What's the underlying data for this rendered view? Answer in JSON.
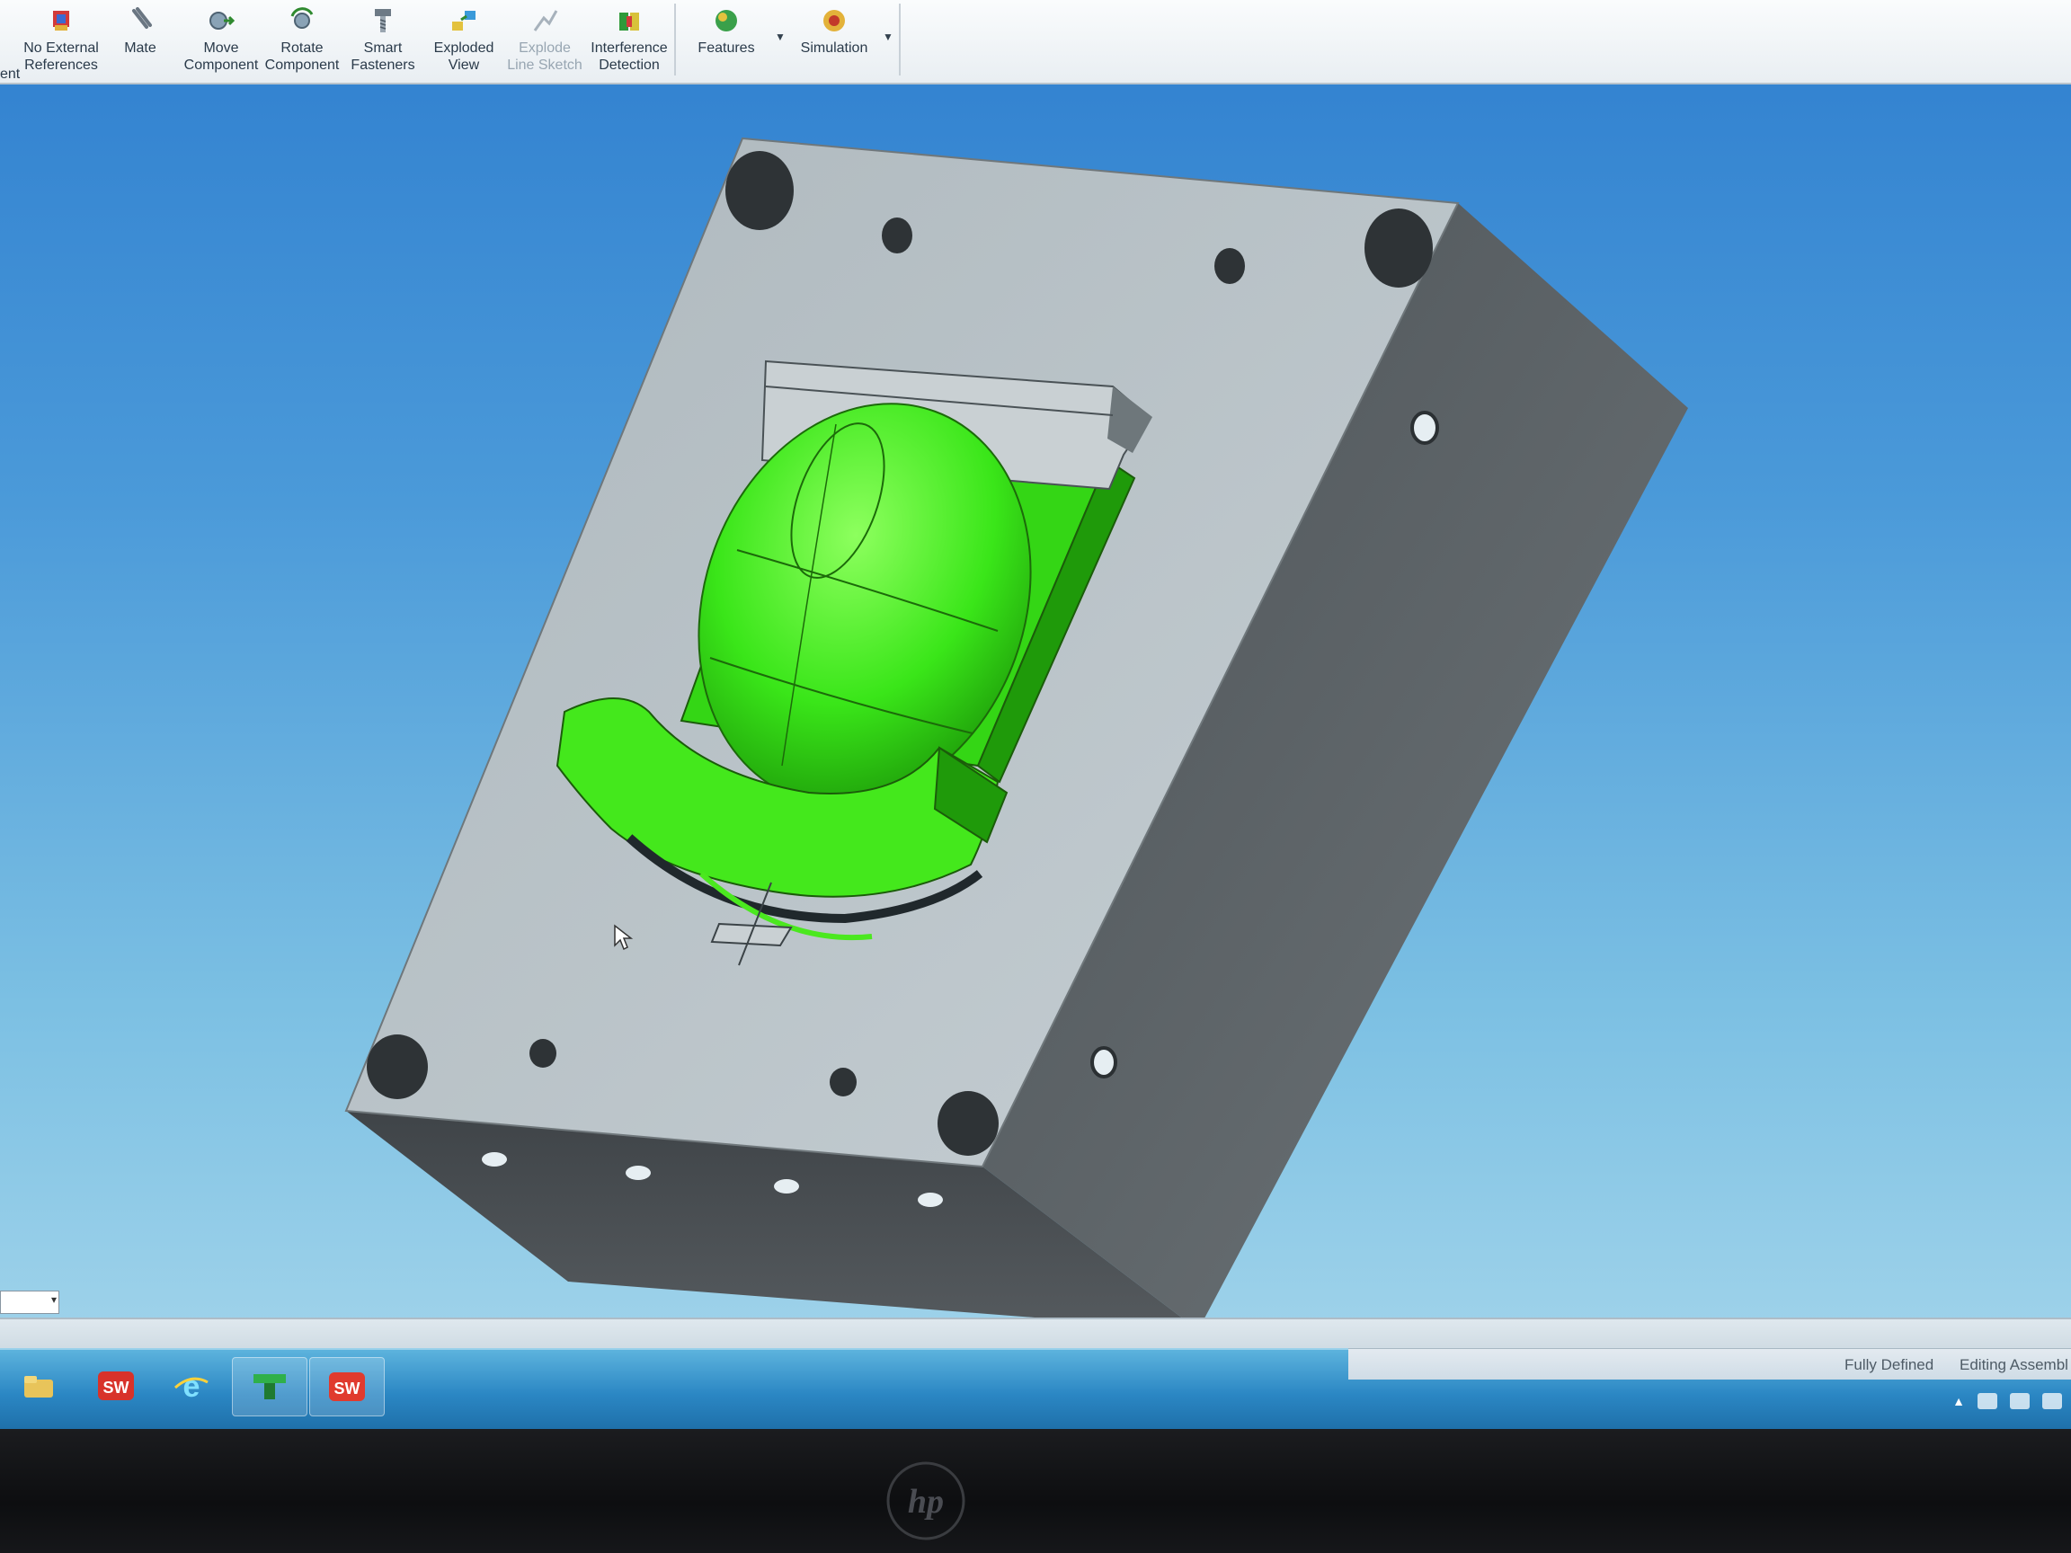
{
  "toolbar": {
    "cut_label": "ent",
    "buttons": [
      {
        "id": "no-external-references",
        "line1": "No External",
        "line2": "References",
        "icon": "no-external-references-icon"
      },
      {
        "id": "mate",
        "line1": "Mate",
        "line2": "",
        "icon": "mate-paperclip-icon"
      },
      {
        "id": "move-component",
        "line1": "Move",
        "line2": "Component",
        "icon": "move-component-icon"
      },
      {
        "id": "rotate-component",
        "line1": "Rotate",
        "line2": "Component",
        "icon": "rotate-component-icon"
      },
      {
        "id": "smart-fasteners",
        "line1": "Smart",
        "line2": "Fasteners",
        "icon": "smart-fasteners-icon"
      },
      {
        "id": "exploded-view",
        "line1": "Exploded",
        "line2": "View",
        "icon": "exploded-view-icon"
      },
      {
        "id": "explode-line-sketch",
        "line1": "Explode",
        "line2": "Line Sketch",
        "icon": "explode-line-sketch-icon",
        "disabled": true
      },
      {
        "id": "interference-detection",
        "line1": "Interference",
        "line2": "Detection",
        "icon": "interference-detection-icon"
      },
      {
        "id": "features",
        "line1": "Features",
        "line2": "",
        "icon": "features-icon"
      },
      {
        "id": "simulation",
        "line1": "Simulation",
        "line2": "",
        "icon": "simulation-icon"
      }
    ]
  },
  "model": {
    "description_name": "mold-base-with-green-mouse-core",
    "colors": {
      "plate_top": "#b3bcc0",
      "plate_right": "#5e6468",
      "plate_front": "#4d5256",
      "core_green": "#33dd11",
      "core_green_light": "#66ff33",
      "viewport_top": "#2f7fcf",
      "viewport_bottom": "#a9d8ec"
    }
  },
  "statusbar": {
    "fully_defined": "Fully Defined",
    "editing": "Editing Assembl"
  },
  "taskbar": {
    "items": [
      {
        "name": "explorer-icon"
      },
      {
        "name": "solidworks-icon"
      },
      {
        "name": "internet-explorer-icon"
      },
      {
        "name": "drafting-app-icon"
      },
      {
        "name": "solidworks-active-icon"
      }
    ]
  },
  "bezel": {
    "logo": "hp"
  }
}
